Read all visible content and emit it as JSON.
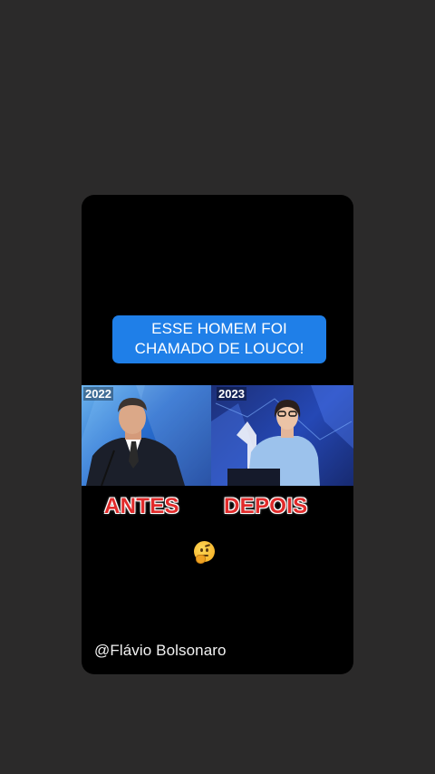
{
  "caption": {
    "line1": "ESSE HOMEM FOI",
    "line2": "CHAMADO DE LOUCO!"
  },
  "photos": {
    "left_year": "2022",
    "right_year": "2023"
  },
  "labels": {
    "before": "ANTES",
    "after": "DEPOIS"
  },
  "emoji": "thinking-face",
  "credit": "@Flávio Bolsonaro",
  "colors": {
    "caption_bg": "#1f7fe8",
    "label_red": "#e12a2a",
    "page_bg": "#2b2a2a",
    "card_bg": "#000000"
  }
}
